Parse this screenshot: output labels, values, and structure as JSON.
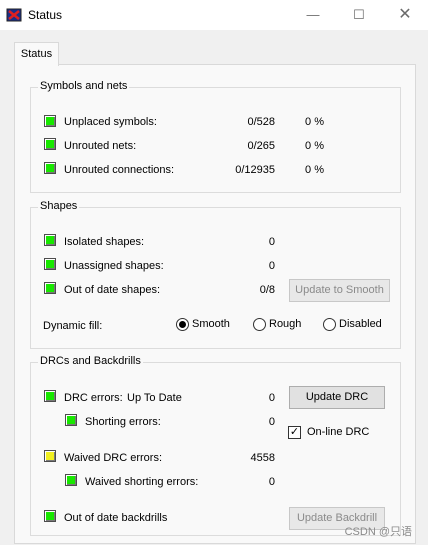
{
  "window": {
    "title": "Status",
    "min_glyph": "—",
    "max_glyph": "☐",
    "close_glyph": "✕"
  },
  "tabs": [
    {
      "label": "Status"
    }
  ],
  "symbols_and_nets": {
    "title": "Symbols and nets",
    "rows": [
      {
        "label": "Unplaced symbols:",
        "count": "0/528",
        "percent": "0 %",
        "color": "#18e800"
      },
      {
        "label": "Unrouted nets:",
        "count": "0/265",
        "percent": "0 %",
        "color": "#18e800"
      },
      {
        "label": "Unrouted connections:",
        "count": "0/12935",
        "percent": "0 %",
        "color": "#18e800"
      }
    ]
  },
  "shapes": {
    "title": "Shapes",
    "rows": [
      {
        "label": "Isolated shapes:",
        "count": "0"
      },
      {
        "label": "Unassigned shapes:",
        "count": "0"
      },
      {
        "label": "Out of date shapes:",
        "count": "0/8"
      }
    ],
    "update_button": "Update to Smooth",
    "dynamic_fill_label": "Dynamic fill:",
    "fill_options": [
      {
        "label": "Smooth",
        "selected": true
      },
      {
        "label": "Rough",
        "selected": false
      },
      {
        "label": "Disabled",
        "selected": false
      }
    ]
  },
  "drcs": {
    "title": "DRCs and Backdrills",
    "drc_errors_label": "DRC errors:",
    "drc_status": "Up To Date",
    "drc_errors_count": "0",
    "shorting_errors_label": "Shorting errors:",
    "shorting_errors_count": "0",
    "waived_drc_label": "Waived DRC errors:",
    "waived_drc_count": "4558",
    "waived_shorting_label": "Waived shorting errors:",
    "waived_shorting_count": "0",
    "backdrills_label": "Out of date backdrills",
    "update_drc_button": "Update DRC",
    "online_drc_label": "On-line DRC",
    "online_drc_checked": true,
    "update_backdrill_button": "Update Backdrill",
    "colors": {
      "ok": "#18e800",
      "warn": "#f0f020"
    }
  },
  "watermark": "CSDN @只语"
}
